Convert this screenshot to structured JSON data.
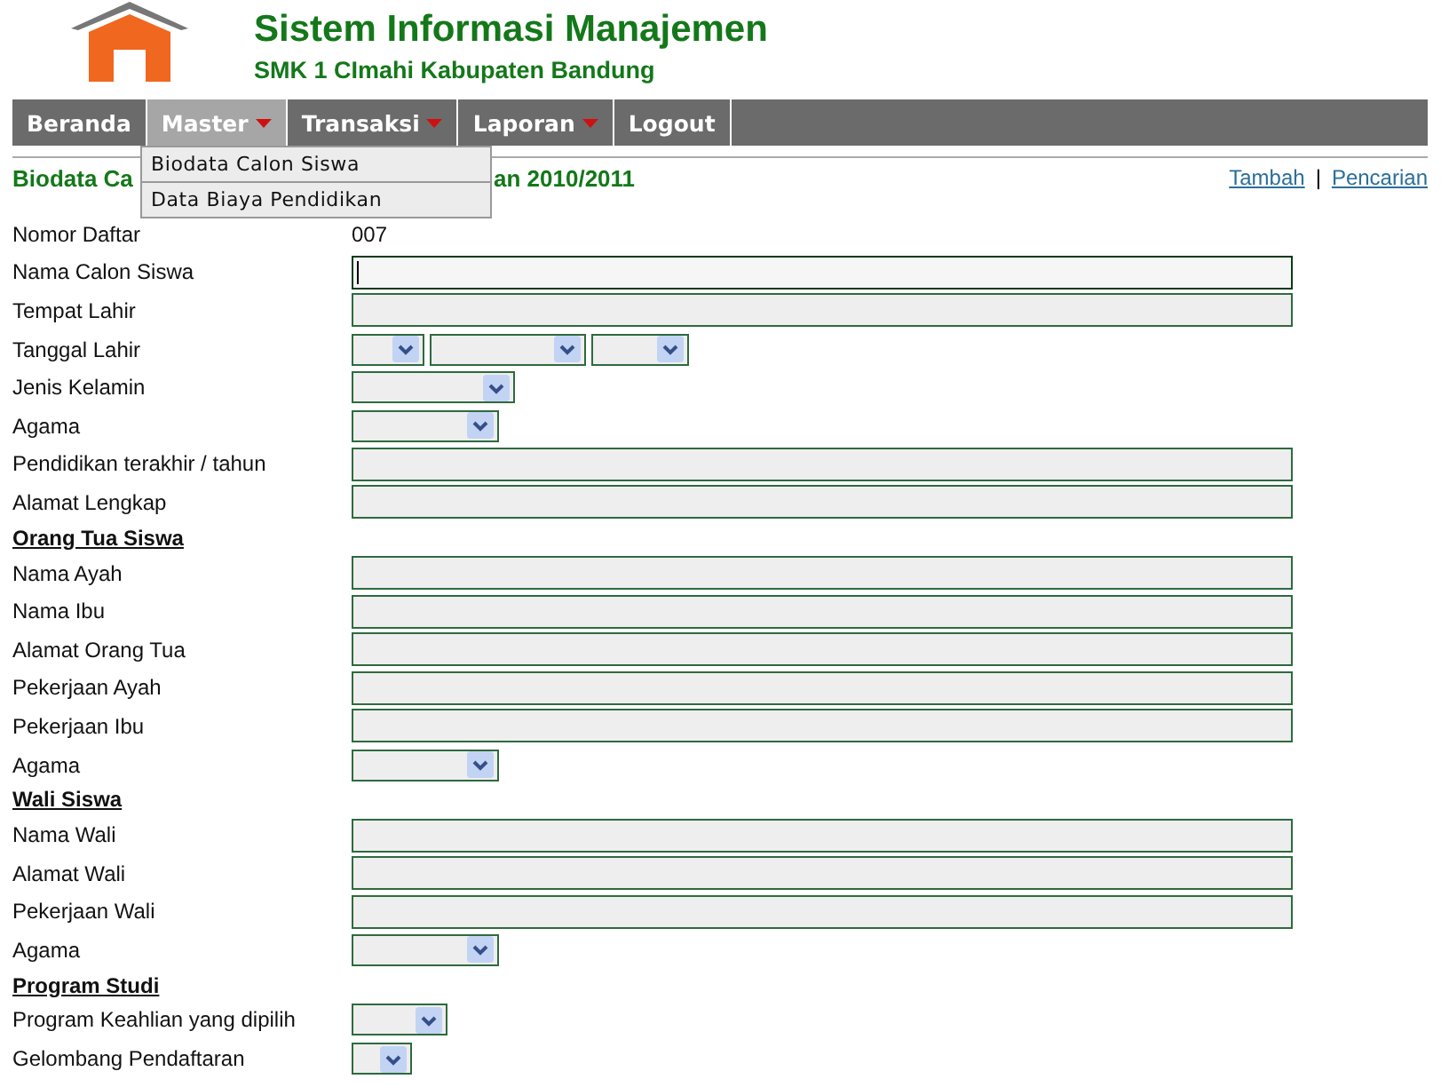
{
  "header": {
    "title": "Sistem Informasi Manajemen",
    "subtitle": "SMK 1 CImahi Kabupaten Bandung"
  },
  "nav": [
    {
      "label": "Beranda",
      "dropdown": false,
      "selected": false
    },
    {
      "label": "Master",
      "dropdown": true,
      "selected": true
    },
    {
      "label": "Transaksi",
      "dropdown": true,
      "selected": false
    },
    {
      "label": "Laporan",
      "dropdown": true,
      "selected": false
    },
    {
      "label": "Logout",
      "dropdown": false,
      "selected": false
    }
  ],
  "menu": [
    "Biodata Calon Siswa",
    "Data Biaya Pendidikan"
  ],
  "heading": {
    "visible_start": "Biodata Ca",
    "visible_end": "an 2010/2011"
  },
  "links": [
    "Tambah",
    "Pencarian"
  ],
  "link_separator": "|",
  "rows": [
    {
      "kind": "value",
      "label": "Nomor Daftar",
      "value": "007"
    },
    {
      "kind": "text",
      "label": "Nama Calon Siswa",
      "focused": true
    },
    {
      "kind": "text",
      "label": "Tempat Lahir",
      "focused": false
    },
    {
      "kind": "select",
      "label": "Tanggal Lahir",
      "selects": [
        {
          "kind": "day"
        },
        {
          "kind": "month"
        },
        {
          "kind": "year"
        }
      ]
    },
    {
      "kind": "select",
      "label": "Jenis Kelamin",
      "selects": [
        {
          "kind": "gender"
        }
      ]
    },
    {
      "kind": "select",
      "label": "Agama",
      "selects": [
        {
          "kind": "religion"
        }
      ]
    },
    {
      "kind": "text",
      "label": "Pendidikan terakhir / tahun",
      "focused": false
    },
    {
      "kind": "text",
      "label": "Alamat Lengkap",
      "focused": false
    },
    {
      "kind": "section",
      "label": "Orang Tua Siswa"
    },
    {
      "kind": "text",
      "label": "Nama Ayah",
      "focused": false
    },
    {
      "kind": "text",
      "label": "Nama Ibu",
      "focused": false
    },
    {
      "kind": "text",
      "label": "Alamat Orang Tua",
      "focused": false
    },
    {
      "kind": "text",
      "label": "Pekerjaan Ayah",
      "focused": false
    },
    {
      "kind": "text",
      "label": "Pekerjaan Ibu",
      "focused": false
    },
    {
      "kind": "select",
      "label": "Agama",
      "selects": [
        {
          "kind": "religion"
        }
      ]
    },
    {
      "kind": "section",
      "label": "Wali Siswa"
    },
    {
      "kind": "text",
      "label": "Nama Wali",
      "focused": false
    },
    {
      "kind": "text",
      "label": "Alamat Wali",
      "focused": false
    },
    {
      "kind": "text",
      "label": "Pekerjaan Wali",
      "focused": false
    },
    {
      "kind": "select",
      "label": "Agama",
      "selects": [
        {
          "kind": "religion"
        }
      ]
    },
    {
      "kind": "section",
      "label": "Program Studi"
    },
    {
      "kind": "select",
      "label": "Program Keahlian yang dipilih",
      "selects": [
        {
          "kind": "program"
        }
      ]
    },
    {
      "kind": "select",
      "label": "Gelombang Pendaftaran",
      "selects": [
        {
          "kind": "wave"
        }
      ]
    }
  ]
}
